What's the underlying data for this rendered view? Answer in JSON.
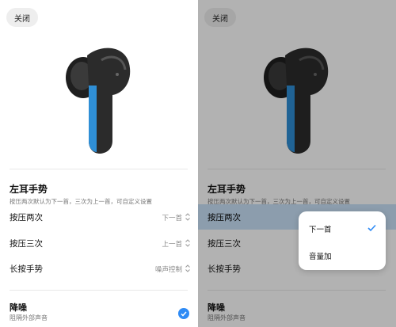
{
  "close_label": "关闭",
  "gesture_section": {
    "title": "左耳手势",
    "subtitle": "按压两次默认为下一首，三次为上一首，可自定义设置"
  },
  "rows": [
    {
      "label": "按压两次",
      "value": "下一首"
    },
    {
      "label": "按压三次",
      "value": "上一首"
    },
    {
      "label": "长按手势",
      "value": "噪声控制"
    }
  ],
  "noise": {
    "title": "降噪",
    "subtitle": "阻隔外部声音",
    "checked": true
  },
  "popup": {
    "options": [
      {
        "label": "下一首",
        "selected": true
      },
      {
        "label": "音量加",
        "selected": false
      }
    ]
  },
  "colors": {
    "accent": "#2f8bf5",
    "earbud_body": "#2b2b2b",
    "earbud_accent": "#2f8fd6"
  }
}
